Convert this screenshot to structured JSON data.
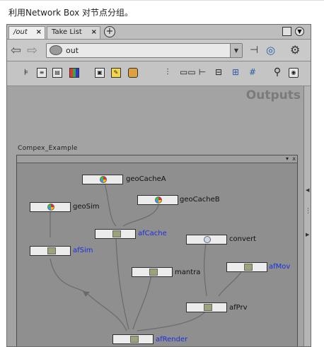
{
  "caption": "利用Network Box 对节点分组。",
  "tabs": [
    {
      "label": "/out",
      "close": "×"
    },
    {
      "label": "Take List",
      "close": "×"
    }
  ],
  "add_tab": "+",
  "path": {
    "value": "out",
    "dropdown": "▼"
  },
  "pane_title": "Outputs",
  "network_box": {
    "title": "Compex_Example",
    "header_buttons": [
      "▾",
      "x"
    ]
  },
  "nodes": [
    {
      "name": "geoCacheA",
      "style": "normal"
    },
    {
      "name": "geoCacheB",
      "style": "normal"
    },
    {
      "name": "geoSim",
      "style": "normal"
    },
    {
      "name": "afCache",
      "style": "blue"
    },
    {
      "name": "convert",
      "style": "normal"
    },
    {
      "name": "afSim",
      "style": "blue"
    },
    {
      "name": "mantra",
      "style": "normal"
    },
    {
      "name": "afMov",
      "style": "blue"
    },
    {
      "name": "afPrv",
      "style": "normal"
    },
    {
      "name": "afRender",
      "style": "blue"
    }
  ],
  "icons": {
    "back": "arrow-left-icon",
    "forward": "arrow-right-icon",
    "pin": "pin-icon",
    "network": "network-icon",
    "settings": "gear-icon",
    "search": "magnifier-icon",
    "eye": "eye-icon"
  }
}
